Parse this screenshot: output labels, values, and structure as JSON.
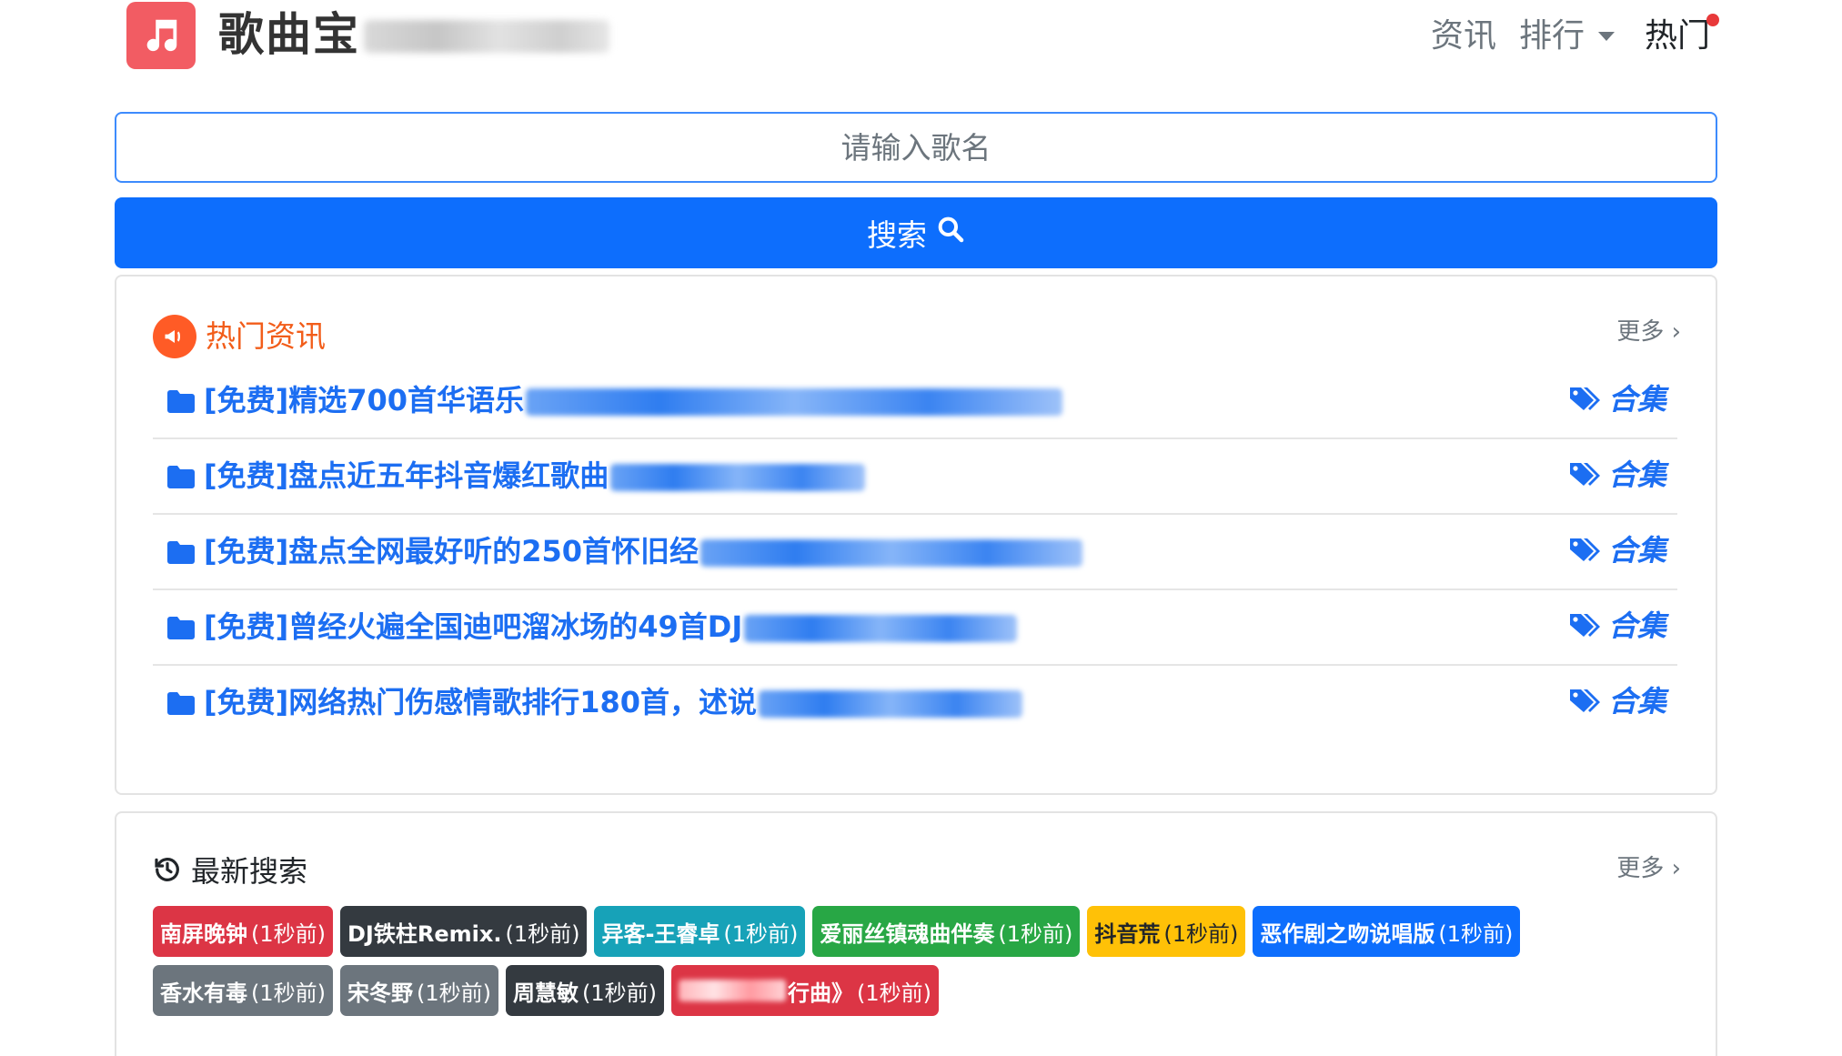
{
  "header": {
    "brand": "歌曲宝",
    "nav": {
      "news": "资讯",
      "rank": "排行",
      "hot": "热门"
    }
  },
  "search": {
    "placeholder": "请输入歌名",
    "button_label": "搜索"
  },
  "news_card": {
    "title": "热门资讯",
    "more": "更多 ›",
    "items": [
      {
        "text": "[免费]精选700首华语乐",
        "tag": "合集"
      },
      {
        "text": "[免费]盘点近五年抖音爆红歌曲",
        "tag": "合集"
      },
      {
        "text": "[免费]盘点全网最好听的250首怀旧经",
        "tag": "合集"
      },
      {
        "text": "[免费]曾经火遍全国迪吧溜冰场的49首DJ",
        "tag": "合集"
      },
      {
        "text": "[免费]网络热门伤感情歌排行180首，述说",
        "tag": "合集"
      }
    ]
  },
  "recent_card": {
    "title": "最新搜索",
    "more": "更多 ›",
    "badges": [
      {
        "name": "南屏晚钟",
        "time": "(1秒前)",
        "color": "#dc3545",
        "text_color": "#ffffff"
      },
      {
        "name": "DJ铁柱Remix.",
        "time": "(1秒前)",
        "color": "#343a40",
        "text_color": "#ffffff"
      },
      {
        "name": "异客-王睿卓",
        "time": "(1秒前)",
        "color": "#17a2b8",
        "text_color": "#ffffff"
      },
      {
        "name": "爱丽丝镇魂曲伴奏",
        "time": "(1秒前)",
        "color": "#28a745",
        "text_color": "#ffffff"
      },
      {
        "name": "抖音荒",
        "time": "(1秒前)",
        "color": "#ffc107",
        "text_color": "#212529"
      },
      {
        "name": "恶作剧之吻说唱版",
        "time": "(1秒前)",
        "color": "#0d6efd",
        "text_color": "#ffffff"
      },
      {
        "name": "香水有毒",
        "time": "(1秒前)",
        "color": "#6c757d",
        "text_color": "#ffffff"
      },
      {
        "name": "宋冬野",
        "time": "(1秒前)",
        "color": "#6c757d",
        "text_color": "#ffffff"
      },
      {
        "name": "周慧敏",
        "time": "(1秒前)",
        "color": "#343a40",
        "text_color": "#ffffff"
      },
      {
        "name": "行曲》",
        "time": "(1秒前)",
        "color": "#dc3545",
        "text_color": "#ffffff"
      }
    ]
  }
}
